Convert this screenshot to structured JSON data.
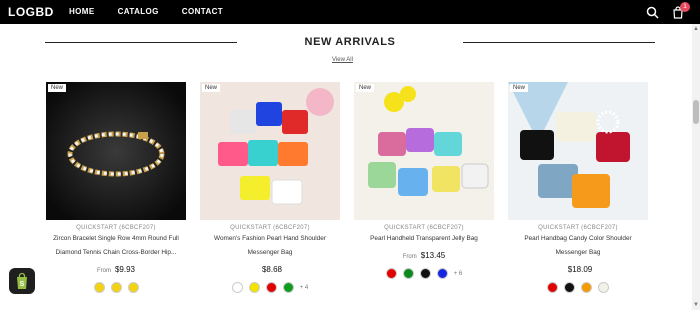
{
  "header": {
    "logo": "LOGBD",
    "nav": [
      "HOME",
      "CATALOG",
      "CONTACT"
    ],
    "cart_count": "1"
  },
  "section": {
    "title": "NEW ARRIVALS",
    "view_all": "View All"
  },
  "products": [
    {
      "badge": "New",
      "vendor": "QUICKSTART (6CBCF207)",
      "title_line1": "Zircon Bracelet Single Row 4mm Round Full",
      "title_line2": "Diamond Tennis Chain Cross-Border Hip...",
      "from": "From",
      "price": "$9.93",
      "swatches": [
        "#f2d214",
        "#f2d214",
        "#f2d214"
      ],
      "more": ""
    },
    {
      "badge": "New",
      "vendor": "QUICKSTART (6CBCF207)",
      "title_line1": "Women's Fashion Pearl Hand Shoulder",
      "title_line2": "Messenger Bag",
      "from": "",
      "price": "$8.68",
      "swatches": [
        "#ffffff",
        "#f2e400",
        "#e00000",
        "#109c1f"
      ],
      "more": "+ 4"
    },
    {
      "badge": "New",
      "vendor": "QUICKSTART (6CBCF207)",
      "title_line1": "Pearl Handheld Transparent Jelly Bag",
      "title_line2": "",
      "from": "From",
      "price": "$13.45",
      "swatches": [
        "#e00000",
        "#0c8a1c",
        "#111111",
        "#1426e0"
      ],
      "more": "+ 6"
    },
    {
      "badge": "New",
      "vendor": "QUICKSTART (6CBCF207)",
      "title_line1": "Pearl Handbag Candy Color Shoulder",
      "title_line2": "Messenger Bag",
      "from": "",
      "price": "$18.09",
      "swatches": [
        "#e00000",
        "#111111",
        "#f59a00",
        "#f4f1e8"
      ],
      "more": ""
    }
  ]
}
